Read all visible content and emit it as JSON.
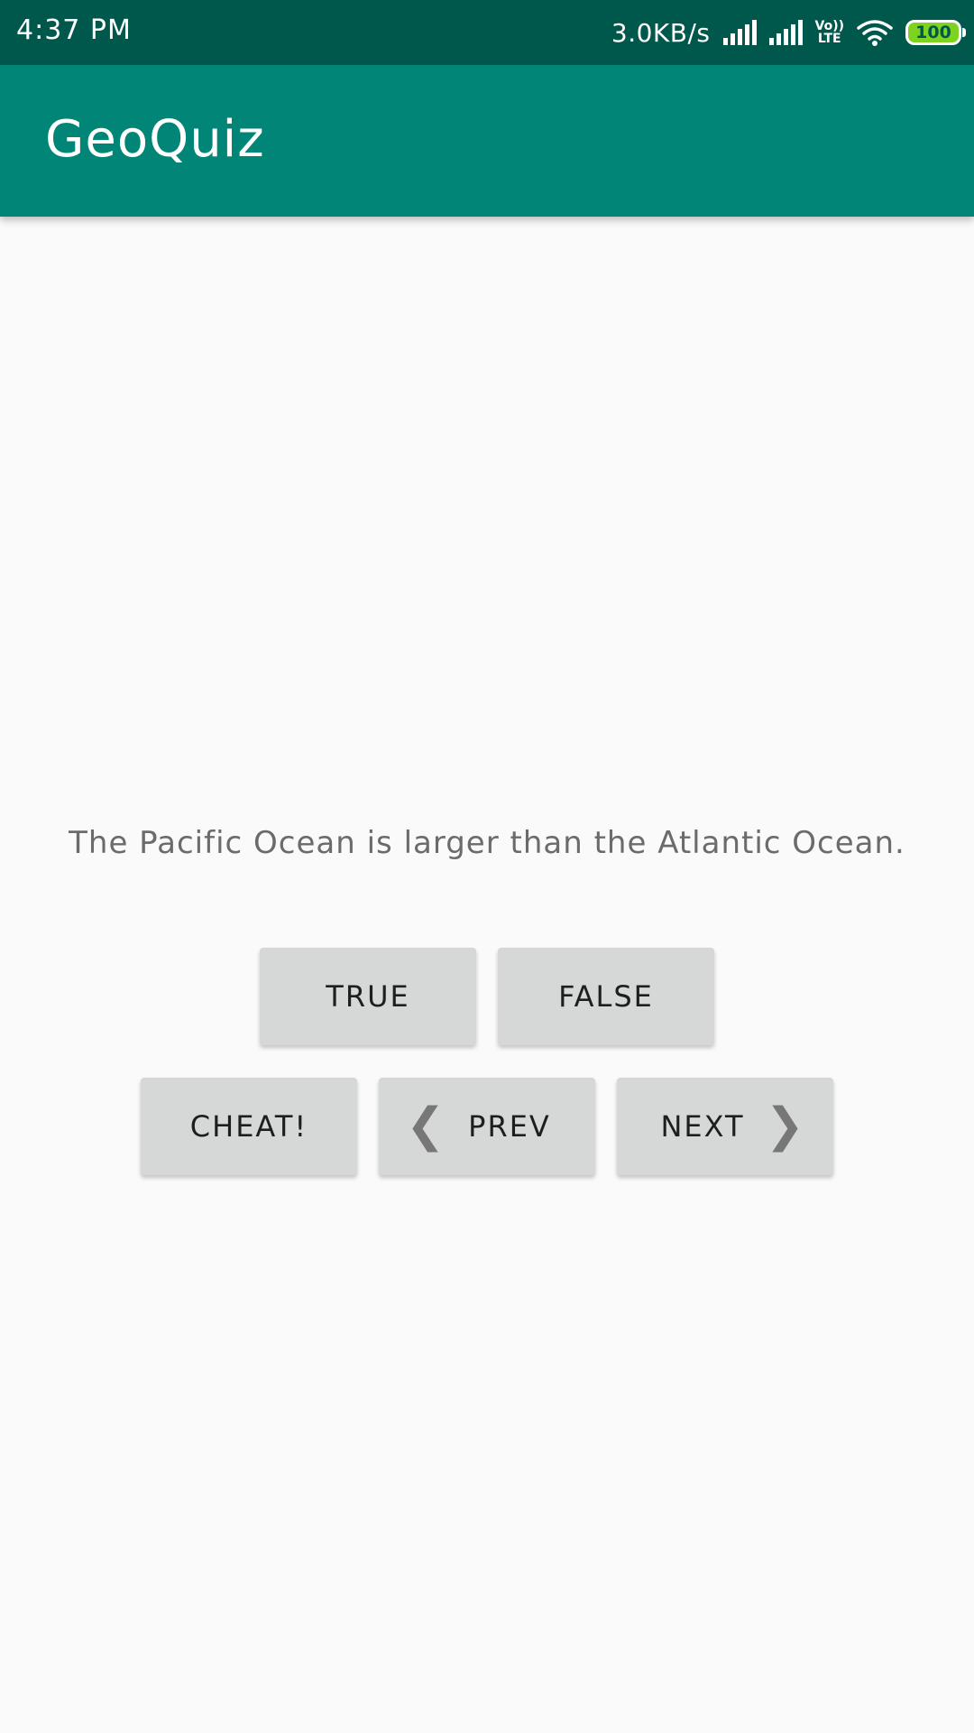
{
  "status_bar": {
    "time": "4:37 PM",
    "net_speed": "3.0KB/s",
    "volte_top": "Vo))",
    "volte_bottom": "LTE",
    "battery_level": "100"
  },
  "app_bar": {
    "title": "GeoQuiz"
  },
  "question": {
    "text": "The Pacific Ocean is larger than the Atlantic Ocean."
  },
  "buttons": {
    "true_label": "TRUE",
    "false_label": "FALSE",
    "cheat_label": "CHEAT!",
    "prev_label": "PREV",
    "next_label": "NEXT"
  },
  "icons": {
    "prev_arrow": "❮",
    "next_arrow": "❯"
  },
  "colors": {
    "status_bar": "#00574b",
    "app_bar": "#008577",
    "button": "#d6d7d7",
    "background": "#fafafa"
  }
}
